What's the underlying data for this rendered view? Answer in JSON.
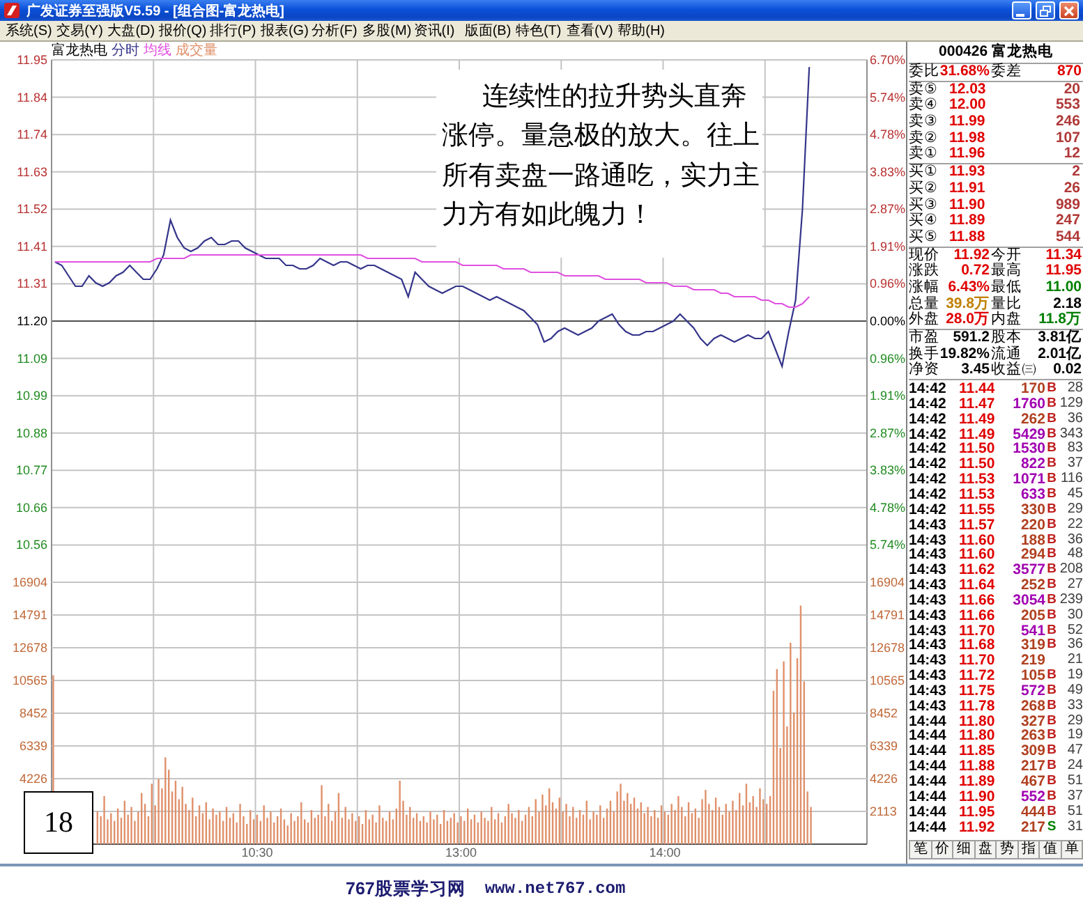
{
  "window": {
    "title": "广发证券至强版V5.59 - [组合图-富龙热电]"
  },
  "menu": [
    "系统(S)",
    "交易(Y)",
    "大盘(D)",
    "报价(Q)",
    "排行(P)",
    "报表(G)",
    "分析(F)",
    "多股(M)",
    "资讯(I)",
    "版面(B)",
    "特色(T)",
    "查看(V)",
    "帮助(H)"
  ],
  "price_chart": {
    "chart_data": {
      "type": "line",
      "title": "富龙热电",
      "grid": true,
      "categories": [
        null,
        null,
        null,
        null,
        null,
        null,
        null,
        null,
        null,
        null,
        null,
        null,
        null,
        null,
        null,
        null,
        null,
        null,
        null,
        null,
        null,
        null,
        null,
        null,
        null,
        null,
        null,
        null,
        null,
        null,
        null,
        null,
        null,
        null,
        null,
        null,
        null,
        null,
        null,
        null,
        null,
        null,
        null,
        null,
        null,
        null,
        null,
        null,
        null,
        null,
        null,
        null,
        null,
        null,
        null,
        null,
        null,
        null,
        null,
        null,
        null,
        null,
        null,
        null,
        null,
        null,
        null,
        null,
        null,
        null,
        null,
        null,
        null,
        null,
        null,
        null,
        null,
        null,
        null,
        null,
        null,
        null,
        null,
        null,
        null,
        null,
        null,
        null,
        null,
        null,
        null,
        null,
        null,
        null,
        null,
        null,
        null,
        null,
        null,
        null,
        null,
        null,
        null,
        null,
        null,
        null,
        null,
        null,
        null,
        null,
        null,
        null,
        null,
        null,
        null,
        null,
        null,
        null,
        null,
        null
      ],
      "ylim": [
        10.4496,
        11.9504
      ],
      "yticks": [
        {
          "value": 11.9504,
          "label": "11.95"
        },
        {
          "value": 11.8432,
          "label": "11.84"
        },
        {
          "value": 11.736,
          "label": "11.74"
        },
        {
          "value": 11.6288,
          "label": "11.63"
        },
        {
          "value": 11.5216,
          "label": "11.52"
        },
        {
          "value": 11.4144,
          "label": "11.41"
        },
        {
          "value": 11.3072,
          "label": "11.31"
        },
        {
          "value": 11.2,
          "label": "11.20"
        },
        {
          "value": 11.0928,
          "label": "11.09"
        },
        {
          "value": 10.9856,
          "label": "10.99"
        },
        {
          "value": 10.8784,
          "label": "10.88"
        },
        {
          "value": 10.7712,
          "label": "10.77"
        },
        {
          "value": 10.664,
          "label": "10.66"
        },
        {
          "value": 10.5568,
          "label": "10.56"
        }
      ],
      "ref_lines": [
        {
          "axis": "y",
          "value": 11.2
        }
      ],
      "series": [
        {
          "name": "分时",
          "color": "#34348a",
          "values": [
            11.37,
            11.36,
            11.33,
            11.3,
            11.3,
            11.33,
            11.31,
            11.3,
            11.31,
            11.33,
            11.34,
            11.36,
            11.34,
            11.32,
            11.32,
            11.35,
            11.39,
            11.49,
            11.44,
            11.41,
            11.4,
            11.41,
            11.43,
            11.44,
            11.42,
            11.42,
            11.43,
            11.43,
            11.41,
            11.4,
            11.39,
            11.38,
            11.38,
            11.38,
            11.36,
            11.36,
            11.35,
            11.35,
            11.36,
            11.38,
            11.37,
            11.36,
            11.37,
            11.37,
            11.36,
            11.35,
            11.36,
            11.36,
            11.35,
            11.34,
            11.33,
            11.32,
            11.27,
            11.34,
            11.32,
            11.3,
            11.29,
            11.28,
            11.29,
            11.3,
            11.3,
            11.29,
            11.28,
            11.27,
            11.26,
            11.27,
            11.26,
            11.25,
            11.24,
            11.23,
            11.21,
            11.19,
            11.14,
            11.15,
            11.17,
            11.18,
            11.17,
            11.16,
            11.17,
            11.18,
            11.2,
            11.21,
            11.22,
            11.19,
            11.17,
            11.16,
            11.16,
            11.17,
            11.17,
            11.18,
            11.19,
            11.2,
            11.22,
            11.2,
            11.18,
            11.15,
            11.13,
            11.15,
            11.16,
            11.15,
            11.14,
            11.15,
            11.16,
            11.15,
            11.15,
            11.17,
            11.12,
            11.07,
            11.17,
            11.26,
            11.52,
            11.93,
            null,
            null,
            null,
            null,
            null,
            null,
            null,
            null
          ]
        },
        {
          "name": "均线",
          "color": "#e050e0",
          "values": [
            11.37,
            11.37,
            11.37,
            11.37,
            11.37,
            11.37,
            11.37,
            11.37,
            11.37,
            11.37,
            11.37,
            11.37,
            11.37,
            11.37,
            11.37,
            11.38,
            11.38,
            11.38,
            11.38,
            11.38,
            11.39,
            11.39,
            11.39,
            11.39,
            11.39,
            11.39,
            11.39,
            11.39,
            11.39,
            11.39,
            11.39,
            11.39,
            11.39,
            11.39,
            11.39,
            11.39,
            11.39,
            11.39,
            11.39,
            11.39,
            11.39,
            11.39,
            11.39,
            11.39,
            11.39,
            11.39,
            11.38,
            11.38,
            11.38,
            11.38,
            11.38,
            11.38,
            11.38,
            11.38,
            11.37,
            11.37,
            11.37,
            11.37,
            11.37,
            11.37,
            11.36,
            11.36,
            11.36,
            11.36,
            11.36,
            11.36,
            11.35,
            11.35,
            11.35,
            11.35,
            11.34,
            11.34,
            11.34,
            11.34,
            11.34,
            11.33,
            11.33,
            11.33,
            11.33,
            11.33,
            11.33,
            11.32,
            11.32,
            11.32,
            11.32,
            11.32,
            11.32,
            11.31,
            11.31,
            11.31,
            11.31,
            11.3,
            11.3,
            11.3,
            11.29,
            11.29,
            11.29,
            11.29,
            11.28,
            11.28,
            11.27,
            11.27,
            11.27,
            11.27,
            11.26,
            11.26,
            11.25,
            11.25,
            11.24,
            11.24,
            11.25,
            11.27,
            null,
            null,
            null,
            null,
            null,
            null,
            null,
            null
          ]
        }
      ]
    },
    "right_labels": [
      "6.70%",
      "5.74%",
      "4.78%",
      "3.83%",
      "2.87%",
      "1.91%",
      "0.96%",
      "0.00%",
      "0.96%",
      "1.91%",
      "2.87%",
      "3.83%",
      "4.78%",
      "5.74%"
    ]
  },
  "volume_chart": {
    "chart_data": {
      "type": "bar",
      "grid": true,
      "categories": [
        null,
        null,
        null,
        null,
        null,
        null,
        null,
        null,
        null,
        null,
        null,
        null,
        null,
        null,
        null,
        null,
        null,
        null,
        null,
        null,
        null,
        null,
        null,
        null,
        null,
        null,
        null,
        null,
        null,
        null,
        null,
        null,
        null,
        null,
        null,
        null,
        null,
        null,
        null,
        null,
        null,
        null,
        null,
        null,
        null,
        null,
        null,
        null,
        null,
        null,
        null,
        null,
        null,
        null,
        null,
        null,
        null,
        null,
        null,
        null,
        "10:30",
        null,
        null,
        null,
        null,
        null,
        null,
        null,
        null,
        null,
        null,
        null,
        null,
        null,
        null,
        null,
        null,
        null,
        null,
        null,
        null,
        null,
        null,
        null,
        null,
        null,
        null,
        null,
        null,
        null,
        null,
        null,
        null,
        null,
        null,
        null,
        null,
        null,
        null,
        null,
        null,
        null,
        null,
        null,
        null,
        null,
        null,
        null,
        null,
        null,
        null,
        null,
        null,
        null,
        null,
        null,
        null,
        null,
        null,
        null,
        "13:00",
        null,
        null,
        null,
        null,
        null,
        null,
        null,
        null,
        null,
        null,
        null,
        null,
        null,
        null,
        null,
        null,
        null,
        null,
        null,
        null,
        null,
        null,
        null,
        null,
        null,
        null,
        null,
        null,
        null,
        null,
        null,
        null,
        null,
        null,
        null,
        null,
        null,
        null,
        null,
        null,
        null,
        null,
        null,
        null,
        null,
        null,
        null,
        null,
        null,
        null,
        null,
        null,
        null,
        null,
        null,
        null,
        null,
        null,
        null,
        "14:00",
        null,
        null,
        null,
        null,
        null,
        null,
        null,
        null,
        null,
        null,
        null,
        null,
        null,
        null,
        null,
        null,
        null,
        null,
        null,
        null,
        null,
        null,
        null,
        null,
        null,
        null,
        null,
        null,
        null,
        null,
        null,
        null,
        null,
        null,
        null,
        null,
        null,
        null,
        null,
        null,
        null,
        null,
        null,
        null,
        null,
        null,
        null,
        null,
        null,
        null,
        null,
        null,
        null,
        null,
        null,
        null,
        null,
        null,
        null
      ],
      "ylim": [
        0,
        16904
      ],
      "yticks": [
        {
          "value": 16904,
          "label": "16904"
        },
        {
          "value": 14791,
          "label": "14791"
        },
        {
          "value": 12678,
          "label": "12678"
        },
        {
          "value": 10565,
          "label": "10565"
        },
        {
          "value": 8452,
          "label": "8452"
        },
        {
          "value": 6339,
          "label": "6339"
        },
        {
          "value": 4226,
          "label": "4226"
        }
      ],
      "series": [
        {
          "name": "成交量",
          "color": "#e0906a",
          "values": [
            10900,
            null,
            null,
            null,
            null,
            null,
            null,
            null,
            null,
            null,
            null,
            null,
            null,
            2100,
            1800,
            3100,
            1600,
            2000,
            1500,
            2300,
            1700,
            2800,
            1900,
            2400,
            1500,
            2100,
            3300,
            2600,
            1800,
            3900,
            2500,
            4200,
            3600,
            5600,
            4800,
            3400,
            4100,
            2900,
            3700,
            2600,
            2200,
            3000,
            1800,
            2500,
            2000,
            2700,
            1600,
            2300,
            1900,
            2100,
            1500,
            2400,
            1700,
            2000,
            1400,
            2600,
            1800,
            1300,
            2200,
            1600,
            1900,
            1500,
            2500,
            1700,
            2100,
            1400,
            1800,
            2300,
            1600,
            1200,
            2000,
            1500,
            1800,
            2700,
            1600,
            1400,
            2200,
            1700,
            1900,
            3800,
            1800,
            2600,
            1500,
            2100,
            3300,
            1700,
            2400,
            1600,
            2000,
            1500,
            1800,
            1300,
            2200,
            1600,
            1900,
            1400,
            2500,
            1700,
            1500,
            2100,
            1600,
            2300,
            4100,
            2800,
            1900,
            2400,
            1700,
            2000,
            1500,
            1800,
            1400,
            2100,
            1600,
            1900,
            1300,
            2200,
            1500,
            1700,
            2000,
            1400,
            1800,
            1500,
            2300,
            1600,
            1900,
            1400,
            2100,
            1700,
            1500,
            2400,
            1600,
            2000,
            1400,
            1800,
            2600,
            2000,
            1700,
            2200,
            1500,
            1900,
            2400,
            1800,
            2900,
            2100,
            3200,
            2500,
            3600,
            2700,
            2300,
            3000,
            2100,
            2600,
            1800,
            2400,
            1700,
            2200,
            1900,
            2800,
            1600,
            2100,
            1900,
            2500,
            1700,
            2300,
            2800,
            2100,
            3400,
            3900,
            2800,
            3300,
            2600,
            3000,
            2300,
            2700,
            2000,
            2400,
            1800,
            2200,
            1700,
            2500,
            2100,
            1900,
            2600,
            2200,
            3100,
            2400,
            1800,
            2700,
            2000,
            2300,
            1700,
            2900,
            3500,
            2600,
            2200,
            3000,
            2400,
            1900,
            2600,
            2100,
            2800,
            2200,
            3300,
            2500,
            3900,
            2700,
            3100,
            2400,
            3600,
            2900,
            2600,
            3100,
            9900,
            11300,
            6200,
            11800,
            7600,
            13000,
            8500,
            12000,
            15400,
            10500,
            3400,
            2400,
            null,
            null,
            null,
            null,
            null,
            null,
            null,
            null,
            null,
            null,
            null,
            null,
            null,
            null,
            null,
            null
          ]
        }
      ]
    },
    "right_labels": [
      "16904",
      "14791",
      "12678",
      "10565",
      "8452",
      "6339",
      "4226",
      "2113"
    ]
  },
  "annotation": "连续性的拉升势头直奔涨停。量急极的放大。往上所有卖盘一路通吃，实力主力方有如此魄力！",
  "page_number": "18",
  "quote_panel": {
    "header": "000426 富龙热电",
    "order_ratio": [
      {
        "label": "委比",
        "value": "31.68%",
        "color": "#e00000"
      },
      {
        "label": "委差",
        "value": "870",
        "color": "#e00000"
      }
    ],
    "asks": [
      {
        "label": "卖⑤",
        "price": "12.03",
        "volume": "20"
      },
      {
        "label": "卖④",
        "price": "12.00",
        "volume": "553"
      },
      {
        "label": "卖③",
        "price": "11.99",
        "volume": "246"
      },
      {
        "label": "卖②",
        "price": "11.98",
        "volume": "107"
      },
      {
        "label": "卖①",
        "price": "11.96",
        "volume": "12"
      }
    ],
    "bids": [
      {
        "label": "买①",
        "price": "11.93",
        "volume": "2"
      },
      {
        "label": "买②",
        "price": "11.91",
        "volume": "26"
      },
      {
        "label": "买③",
        "price": "11.90",
        "volume": "989"
      },
      {
        "label": "买④",
        "price": "11.89",
        "volume": "247"
      },
      {
        "label": "买⑤",
        "price": "11.88",
        "volume": "544"
      }
    ],
    "quote": [
      [
        {
          "label": "现价",
          "value": "11.92",
          "color": "#e00000"
        },
        {
          "label": "今开",
          "value": "11.34",
          "color": "#e00000"
        }
      ],
      [
        {
          "label": "涨跌",
          "value": "0.72",
          "color": "#e00000"
        },
        {
          "label": "最高",
          "value": "11.95",
          "color": "#e00000"
        }
      ],
      [
        {
          "label": "涨幅",
          "value": "6.43%",
          "color": "#e00000"
        },
        {
          "label": "最低",
          "value": "11.00",
          "color": "#008000"
        }
      ],
      [
        {
          "label": "总量",
          "value": "39.8万",
          "color": "#c08000"
        },
        {
          "label": "量比",
          "value": "2.18",
          "color": "#000000"
        }
      ],
      [
        {
          "label": "外盘",
          "value": "28.0万",
          "color": "#e00000"
        },
        {
          "label": "内盘",
          "value": "11.8万",
          "color": "#008000"
        }
      ]
    ],
    "fundamentals": [
      [
        {
          "label": "市盈",
          "value": "591.2",
          "color": "#000000"
        },
        {
          "label": "股本",
          "value": "3.81亿",
          "color": "#000000"
        }
      ],
      [
        {
          "label": "换手",
          "value": "19.82%",
          "color": "#000000"
        },
        {
          "label": "流通",
          "value": "2.01亿",
          "color": "#000000"
        }
      ],
      [
        {
          "label": "净资",
          "value": "3.45",
          "color": "#000000"
        },
        {
          "label": "收益㈢",
          "value": "0.02",
          "color": "#000000"
        }
      ]
    ],
    "ticks": [
      {
        "time": "14:42",
        "price": "11.44",
        "volume": "170",
        "side": "B",
        "count": "28",
        "kind": "buy",
        "large": false
      },
      {
        "time": "14:42",
        "price": "11.47",
        "volume": "1760",
        "side": "B",
        "count": "129",
        "kind": "buy",
        "large": true
      },
      {
        "time": "14:42",
        "price": "11.49",
        "volume": "262",
        "side": "B",
        "count": "36",
        "kind": "buy",
        "large": false
      },
      {
        "time": "14:42",
        "price": "11.49",
        "volume": "5429",
        "side": "B",
        "count": "343",
        "kind": "buy",
        "large": true
      },
      {
        "time": "14:42",
        "price": "11.50",
        "volume": "1530",
        "side": "B",
        "count": "83",
        "kind": "buy",
        "large": true
      },
      {
        "time": "14:42",
        "price": "11.50",
        "volume": "822",
        "side": "B",
        "count": "37",
        "kind": "buy",
        "large": true
      },
      {
        "time": "14:42",
        "price": "11.53",
        "volume": "1071",
        "side": "B",
        "count": "116",
        "kind": "buy",
        "large": true
      },
      {
        "time": "14:42",
        "price": "11.53",
        "volume": "633",
        "side": "B",
        "count": "45",
        "kind": "buy",
        "large": true
      },
      {
        "time": "14:42",
        "price": "11.55",
        "volume": "330",
        "side": "B",
        "count": "29",
        "kind": "buy",
        "large": false
      },
      {
        "time": "14:43",
        "price": "11.57",
        "volume": "220",
        "side": "B",
        "count": "22",
        "kind": "buy",
        "large": false
      },
      {
        "time": "14:43",
        "price": "11.60",
        "volume": "188",
        "side": "B",
        "count": "36",
        "kind": "buy",
        "large": false
      },
      {
        "time": "14:43",
        "price": "11.60",
        "volume": "294",
        "side": "B",
        "count": "48",
        "kind": "buy",
        "large": false
      },
      {
        "time": "14:43",
        "price": "11.62",
        "volume": "3577",
        "side": "B",
        "count": "208",
        "kind": "buy",
        "large": true
      },
      {
        "time": "14:43",
        "price": "11.64",
        "volume": "252",
        "side": "B",
        "count": "27",
        "kind": "buy",
        "large": false
      },
      {
        "time": "14:43",
        "price": "11.66",
        "volume": "3054",
        "side": "B",
        "count": "239",
        "kind": "buy",
        "large": true
      },
      {
        "time": "14:43",
        "price": "11.66",
        "volume": "205",
        "side": "B",
        "count": "30",
        "kind": "buy",
        "large": false
      },
      {
        "time": "14:43",
        "price": "11.70",
        "volume": "541",
        "side": "B",
        "count": "52",
        "kind": "buy",
        "large": true
      },
      {
        "time": "14:43",
        "price": "11.68",
        "volume": "319",
        "side": "B",
        "count": "36",
        "kind": "buy",
        "large": false
      },
      {
        "time": "14:43",
        "price": "11.70",
        "volume": "219",
        "count": "21",
        "large": false
      },
      {
        "time": "14:43",
        "price": "11.72",
        "volume": "105",
        "side": "B",
        "count": "19",
        "kind": "buy",
        "large": false
      },
      {
        "time": "14:43",
        "price": "11.75",
        "volume": "572",
        "side": "B",
        "count": "49",
        "kind": "buy",
        "large": true
      },
      {
        "time": "14:43",
        "price": "11.78",
        "volume": "268",
        "side": "B",
        "count": "33",
        "kind": "buy",
        "large": false
      },
      {
        "time": "14:44",
        "price": "11.80",
        "volume": "327",
        "side": "B",
        "count": "29",
        "kind": "buy",
        "large": false
      },
      {
        "time": "14:44",
        "price": "11.80",
        "volume": "263",
        "side": "B",
        "count": "19",
        "kind": "buy",
        "large": false
      },
      {
        "time": "14:44",
        "price": "11.85",
        "volume": "309",
        "side": "B",
        "count": "47",
        "kind": "buy",
        "large": false
      },
      {
        "time": "14:44",
        "price": "11.88",
        "volume": "217",
        "side": "B",
        "count": "24",
        "kind": "buy",
        "large": false
      },
      {
        "time": "14:44",
        "price": "11.89",
        "volume": "467",
        "side": "B",
        "count": "51",
        "kind": "buy",
        "large": false
      },
      {
        "time": "14:44",
        "price": "11.90",
        "volume": "552",
        "side": "B",
        "count": "37",
        "kind": "buy",
        "large": true
      },
      {
        "time": "14:44",
        "price": "11.95",
        "volume": "444",
        "side": "B",
        "count": "51",
        "kind": "buy",
        "large": false
      },
      {
        "time": "14:44",
        "price": "11.92",
        "volume": "217",
        "side": "S",
        "count": "31",
        "kind": "sell",
        "large": false
      }
    ],
    "tabs": [
      {
        "label": "笔",
        "selected": false
      },
      {
        "label": "价",
        "selected": false
      },
      {
        "label": "细",
        "selected": false
      },
      {
        "label": "盘",
        "selected": false
      },
      {
        "label": "势",
        "selected": false
      },
      {
        "label": "指",
        "selected": false
      },
      {
        "label": "值",
        "selected": false
      },
      {
        "label": "单",
        "selected": false
      }
    ]
  },
  "caption": {
    "site": "767股票学习网",
    "url": "www.net767.com"
  }
}
